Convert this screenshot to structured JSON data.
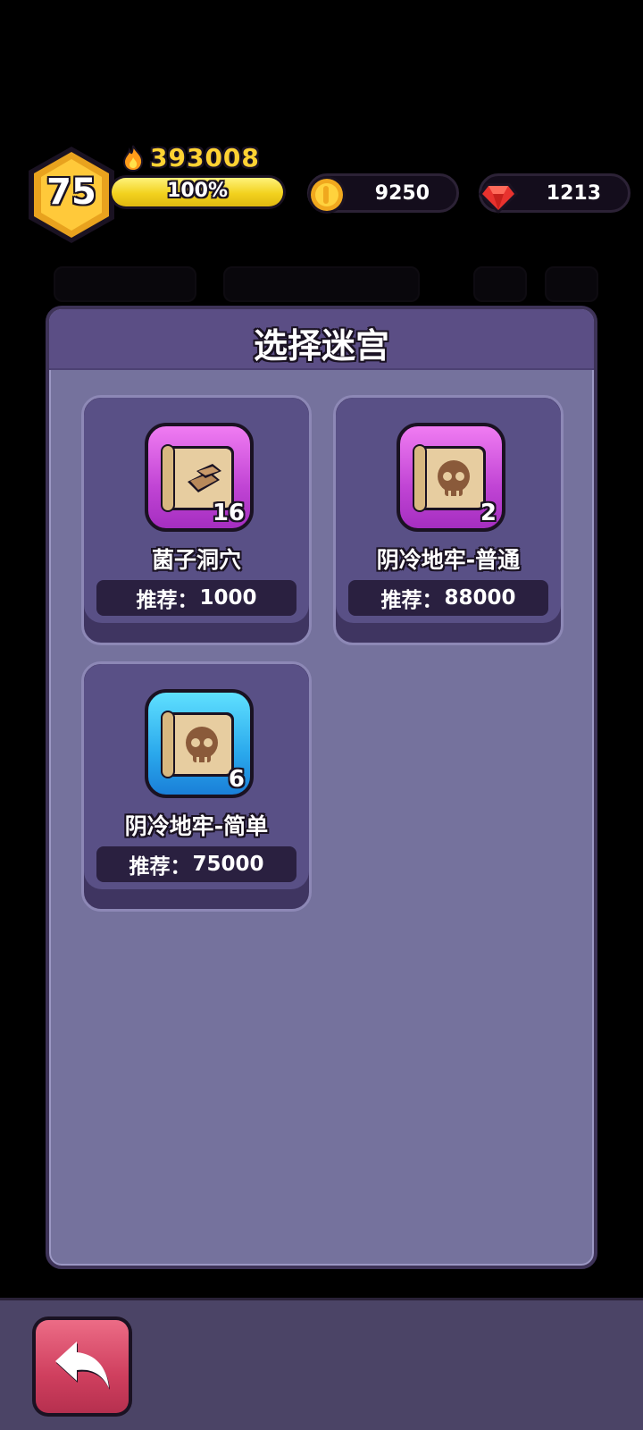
{
  "hud": {
    "level": "75",
    "power": "393008",
    "xp_percent": "100%",
    "xp_fraction": 1.0,
    "coins": "9250",
    "gems": "1213",
    "icons": {
      "power": "flame-icon",
      "coins": "coin-icon",
      "gems": "gem-icon"
    }
  },
  "panel": {
    "title": "选择迷宫",
    "cards": [
      {
        "name": "菌子洞穴",
        "count": "16",
        "rec_label": "推荐：",
        "rec_value": "1000",
        "icon": "scroll-gold-icon",
        "theme": "purple"
      },
      {
        "name": "阴冷地牢-普通",
        "count": "2",
        "rec_label": "推荐：",
        "rec_value": "88000",
        "icon": "scroll-skull-icon",
        "theme": "purple"
      },
      {
        "name": "阴冷地牢-简单",
        "count": "6",
        "rec_label": "推荐：",
        "rec_value": "75000",
        "icon": "scroll-skull-icon",
        "theme": "blue"
      }
    ]
  },
  "footer": {
    "back_icon": "back-arrow-icon"
  },
  "colors": {
    "gold": "#ffd233",
    "panel": "#75729d",
    "header": "#5b4e85",
    "back": "#cf3f5e"
  }
}
